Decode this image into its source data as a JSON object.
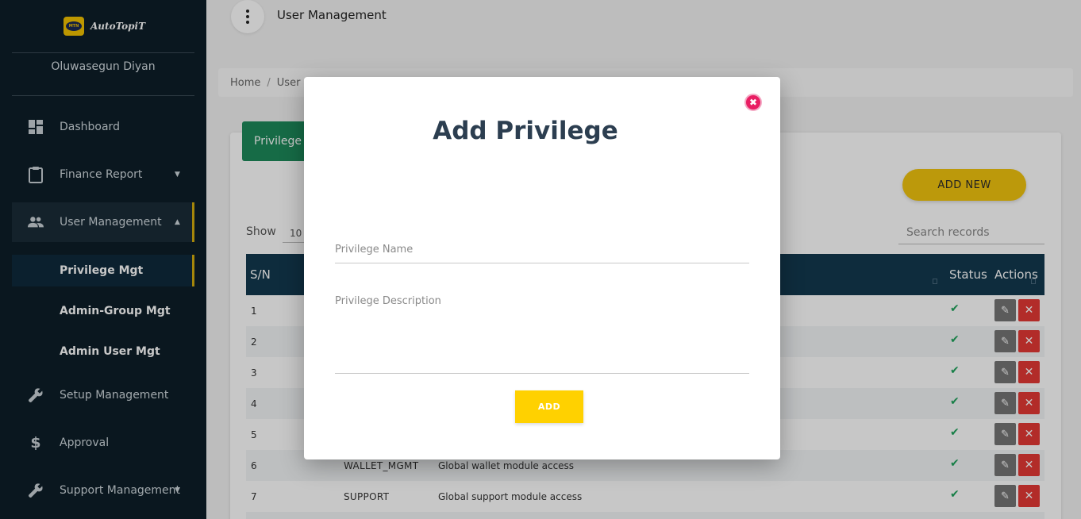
{
  "app": {
    "logo_text": "AutoTopiT",
    "logo_badge": "MTN",
    "user_name": "Oluwasegun Diyan"
  },
  "sidebar": {
    "items": [
      {
        "label": "Dashboard",
        "icon": "dashboard-icon"
      },
      {
        "label": "Finance Report",
        "icon": "clipboard-icon",
        "caret": "▼"
      },
      {
        "label": "User Management",
        "icon": "people-icon",
        "caret": "▲"
      },
      {
        "label": "Setup Management",
        "icon": "wrench-icon"
      },
      {
        "label": "Approval",
        "icon": "dollar-icon"
      },
      {
        "label": "Support Management",
        "icon": "wrench-icon",
        "caret": "▼"
      }
    ],
    "sub_items": [
      {
        "label": "Privilege Mgt"
      },
      {
        "label": "Admin-Group Mgt"
      },
      {
        "label": "Admin User Mgt"
      }
    ]
  },
  "header": {
    "title": "User Management"
  },
  "breadcrumb": {
    "home": "Home",
    "separator": "/",
    "current": "User"
  },
  "card": {
    "tab_label": "Privilege",
    "add_new_label": "ADD NEW",
    "show_label": "Show",
    "show_value": "10",
    "search_placeholder": "Search records"
  },
  "table": {
    "headers": {
      "sn": "S/N",
      "status": "Status",
      "actions": "Actions"
    },
    "rows": [
      {
        "sn": "1",
        "code": "",
        "desc": "",
        "status": "✔"
      },
      {
        "sn": "2",
        "code": "",
        "desc": "",
        "status": "✔"
      },
      {
        "sn": "3",
        "code": "",
        "desc": "",
        "status": "✔"
      },
      {
        "sn": "4",
        "code": "",
        "desc": "",
        "status": "✔"
      },
      {
        "sn": "5",
        "code": "",
        "desc": "",
        "status": "✔"
      },
      {
        "sn": "6",
        "code": "WALLET_MGMT",
        "desc": "Global wallet module access",
        "status": "✔"
      },
      {
        "sn": "7",
        "code": "SUPPORT",
        "desc": "Global support module access",
        "status": "✔"
      }
    ]
  },
  "modal": {
    "title": "Add Privilege",
    "name_label": "Privilege Name",
    "description_label": "Privilege Description",
    "add_label": "ADD",
    "close_glyph": "✖"
  },
  "colors": {
    "sidebar_bg": "#0d1e28",
    "accent_yellow": "#f1c40f",
    "table_header": "#13394f",
    "tab_green": "#1d8a5a",
    "delete_red": "#e53935",
    "close_pink": "#e91e63"
  }
}
